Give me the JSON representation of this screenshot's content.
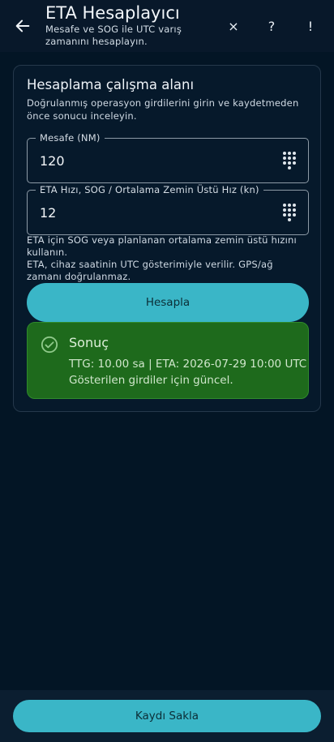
{
  "appbar": {
    "title": "ETA Hesaplayıcı",
    "subtitle": "Mesafe ve SOG ile UTC varış zamanını hesaplayın.",
    "close_glyph": "×",
    "help_glyph": "?",
    "info_glyph": "!"
  },
  "workspace": {
    "title": "Hesaplama çalışma alanı",
    "description": "Doğrulanmış operasyon girdilerini girin ve kaydetmeden önce sonucu inceleyin.",
    "distance": {
      "label": "Mesafe (NM)",
      "value": "120"
    },
    "speed": {
      "label": "ETA Hızı, SOG / Ortalama Zemin Üstü Hız (kn)",
      "value": "12"
    },
    "helper_line1": "ETA için SOG veya planlanan ortalama zemin üstü hızını kullanın.",
    "helper_line2": "ETA, cihaz saatinin UTC gösterimiyle verilir. GPS/ağ zamanı doğrulanmaz.",
    "calculate_label": "Hesapla"
  },
  "result": {
    "title": "Sonuç",
    "line1": "TTG: 10.00 sa | ETA: 2026-07-29 10:00 UTC",
    "line2": "Gösterilen girdiler için güncel."
  },
  "footer": {
    "save_label": "Kaydı Sakla"
  },
  "colors": {
    "background": "#031525",
    "accent": "#3ab6c7",
    "success_bg": "#1e6a1c"
  },
  "icons": {
    "back": "arrow-left-icon",
    "close": "close-icon",
    "help": "help-icon",
    "info": "info-icon",
    "dialpad": "dialpad-icon",
    "check": "check-circle-icon"
  }
}
